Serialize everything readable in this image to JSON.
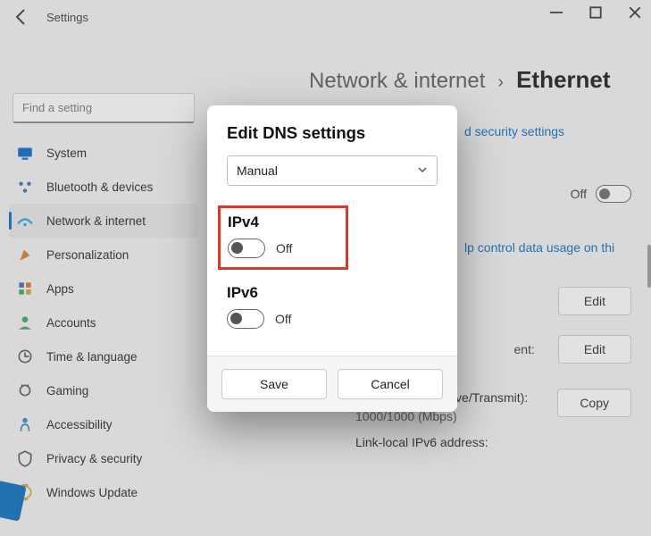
{
  "window": {
    "title": "Settings"
  },
  "search": {
    "placeholder": "Find a setting"
  },
  "sidebar": {
    "items": [
      {
        "label": "System",
        "color": "#0060c0"
      },
      {
        "label": "Bluetooth & devices",
        "color": "#3a66b0"
      },
      {
        "label": "Network & internet",
        "color": "#1aa0dc",
        "selected": true
      },
      {
        "label": "Personalization",
        "color": "#d87b2a"
      },
      {
        "label": "Apps",
        "color": "#3a66b0"
      },
      {
        "label": "Accounts",
        "color": "#3aa05a"
      },
      {
        "label": "Time & language",
        "color": "#555"
      },
      {
        "label": "Gaming",
        "color": "#555"
      },
      {
        "label": "Accessibility",
        "color": "#2a88c8"
      },
      {
        "label": "Privacy & security",
        "color": "#555"
      },
      {
        "label": "Windows Update",
        "color": "#d0a030"
      }
    ]
  },
  "breadcrumb": {
    "parent": "Network & internet",
    "separator": "›",
    "current": "Ethernet"
  },
  "main": {
    "security_link_fragment": "d security settings",
    "off_label": "Off",
    "usage_fragment": "lp control data usage on thi",
    "edit_label": "Edit",
    "edit_label_2": "Edit",
    "row_tail": "ent:",
    "link_speed_label": "Link speed (Receive/Transmit):",
    "link_speed_value": "1000/1000 (Mbps)",
    "ipv6_label": "Link-local IPv6 address:",
    "copy_label": "Copy"
  },
  "dialog": {
    "title": "Edit DNS settings",
    "mode": "Manual",
    "ipv4": {
      "title": "IPv4",
      "state": "Off"
    },
    "ipv6": {
      "title": "IPv6",
      "state": "Off"
    },
    "save": "Save",
    "cancel": "Cancel"
  }
}
